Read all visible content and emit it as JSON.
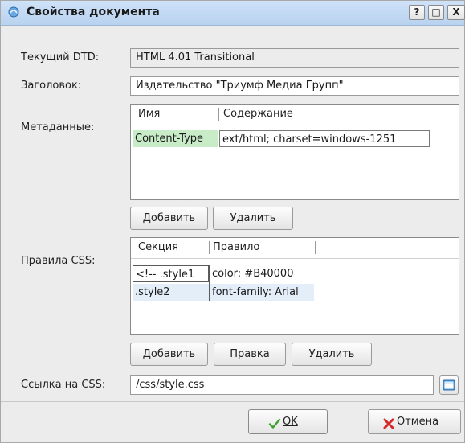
{
  "window": {
    "title": "Свойства документа",
    "help_btn": "?",
    "max_btn": "□",
    "close_btn": "X"
  },
  "fields": {
    "dtd_label": "Текущий DTD:",
    "dtd_value": "HTML 4.01 Transitional",
    "title_label": "Заголовок:",
    "title_value": "Издательство \"Триумф Медиа Групп\"",
    "meta_label": "Метаданные:",
    "css_rules_label": "Правила CSS:",
    "css_link_label": "Ссылка на CSS:",
    "css_link_value": "/css/style.css"
  },
  "metadata": {
    "headers": [
      "Имя",
      "Содержание"
    ],
    "rows": [
      {
        "name": "Content-Type",
        "content": "ext/html; charset=windows-1251"
      }
    ],
    "add_btn": "Добавить",
    "remove_btn": "Удалить"
  },
  "css_rules": {
    "headers": [
      "Секция",
      "Правило"
    ],
    "rows": [
      {
        "section": "<!-- .style1",
        "rule": "color: #B40000"
      },
      {
        "section": ".style2",
        "rule": "font-family: Arial"
      }
    ],
    "add_btn": "Добавить",
    "edit_btn": "Правка",
    "remove_btn": "Удалить"
  },
  "dialog_buttons": {
    "ok_label": "OK",
    "cancel_label": "Отмена"
  },
  "colors": {
    "selection_green": "#c8ecc8",
    "selection_blue": "#e4eef9",
    "title_bar": "#c4daf3"
  }
}
